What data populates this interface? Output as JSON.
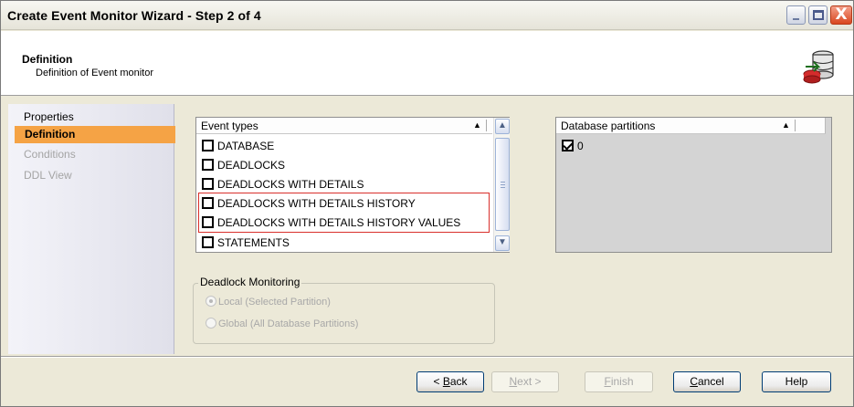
{
  "window": {
    "title": "Create Event Monitor Wizard - Step 2 of 4",
    "min_glyph": "_",
    "close_glyph": "X"
  },
  "header": {
    "title": "Definition",
    "subtitle": "Definition of Event monitor",
    "icon": "database-monitor-icon"
  },
  "nav": {
    "items": [
      {
        "label": "Properties",
        "state": "normal"
      },
      {
        "label": "Definition",
        "state": "active"
      },
      {
        "label": "Conditions",
        "state": "disabled"
      },
      {
        "label": "DDL View",
        "state": "disabled"
      }
    ]
  },
  "event_types": {
    "header": "Event types",
    "sort_glyph": "▲",
    "items": [
      {
        "label": "DATABASE",
        "checked": false
      },
      {
        "label": "DEADLOCKS",
        "checked": false
      },
      {
        "label": "DEADLOCKS WITH DETAILS",
        "checked": false
      },
      {
        "label": "DEADLOCKS WITH DETAILS HISTORY",
        "checked": false
      },
      {
        "label": "DEADLOCKS WITH DETAILS HISTORY VALUES",
        "checked": false
      },
      {
        "label": "STATEMENTS",
        "checked": false
      }
    ],
    "scroll_up_glyph": "▲",
    "scroll_down_glyph": "▼"
  },
  "database_partitions": {
    "header": "Database partitions",
    "sort_glyph": "▲",
    "items": [
      {
        "label": "0",
        "checked": true
      }
    ]
  },
  "deadlock_monitoring": {
    "legend": "Deadlock Monitoring",
    "options": [
      {
        "label": "Local (Selected  Partition)",
        "selected": true
      },
      {
        "label": "Global (All Database Partitions)",
        "selected": false
      }
    ]
  },
  "buttons": {
    "back": {
      "mnemonic": "B",
      "rest": "ack",
      "prefix": "< "
    },
    "next": {
      "mnemonic": "N",
      "rest": "ext >"
    },
    "finish": {
      "mnemonic": "F",
      "rest": "inish"
    },
    "cancel": {
      "mnemonic": "C",
      "rest": "ancel"
    },
    "help": "Help"
  },
  "colors": {
    "nav_active": "#f5a345",
    "highlight_box": "#d9302c"
  }
}
